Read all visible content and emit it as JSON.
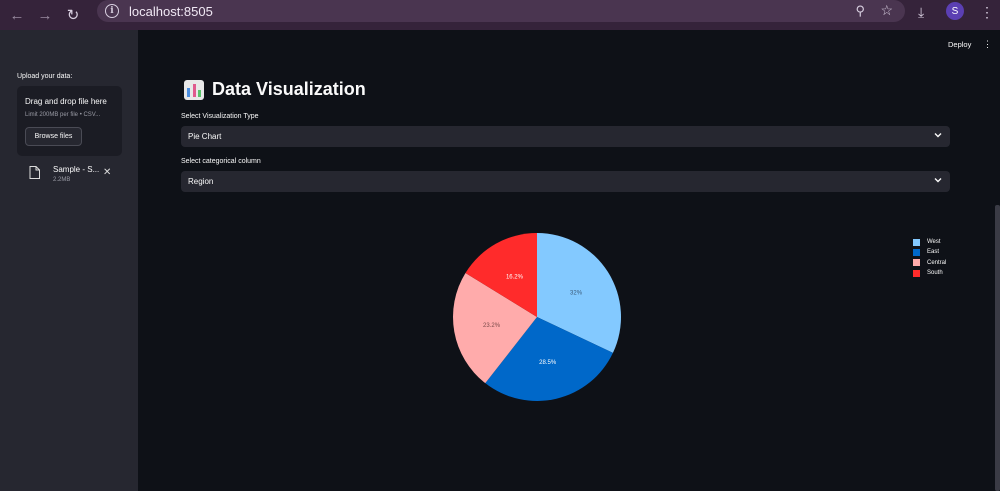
{
  "browser": {
    "url": "localhost:8505",
    "profile_initial": "S"
  },
  "sidebar": {
    "upload_label": "Upload your data:",
    "dropzone_title": "Drag and drop file here",
    "dropzone_limit": "Limit 200MB per file • CSV...",
    "browse_label": "Browse files",
    "file": {
      "name": "Sample - S...",
      "size": "2.2MB"
    }
  },
  "header": {
    "deploy_label": "Deploy"
  },
  "main": {
    "title": "Data Visualization",
    "viz_type_label": "Select Visualization Type",
    "viz_type_value": "Pie Chart",
    "cat_col_label": "Select categorical column",
    "cat_col_value": "Region"
  },
  "chart_data": {
    "type": "pie",
    "categories": [
      "West",
      "East",
      "Central",
      "South"
    ],
    "values": [
      32,
      28.5,
      23.2,
      16.2
    ],
    "labels": [
      "32%",
      "28.5%",
      "23.2%",
      "16.2%"
    ],
    "colors": [
      "#83c9ff",
      "#0068c9",
      "#ffabab",
      "#ff2b2b"
    ],
    "label_colors": [
      "#3b5a78",
      "#ffffff",
      "#7a4a4a",
      "#ffffff"
    ],
    "legend_position": "right"
  }
}
